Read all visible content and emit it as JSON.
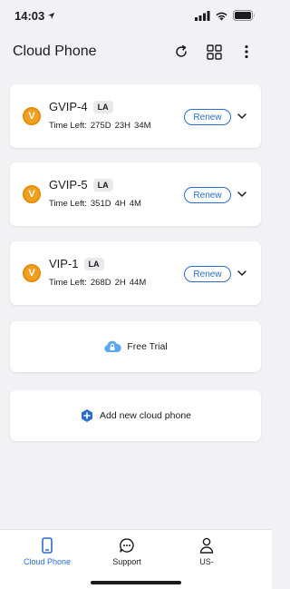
{
  "status_bar": {
    "time": "14:03"
  },
  "header": {
    "title": "Cloud Phone"
  },
  "phones": [
    {
      "badge": "V",
      "name": "GVIP-4",
      "region": "LA",
      "time_label": "Time Left:",
      "days": "275D",
      "hours": "23H",
      "minutes": "34M",
      "renew_label": "Renew"
    },
    {
      "badge": "V",
      "name": "GVIP-5",
      "region": "LA",
      "time_label": "Time Left:",
      "days": "351D",
      "hours": "4H",
      "minutes": "4M",
      "renew_label": "Renew"
    },
    {
      "badge": "V",
      "name": "VIP-1",
      "region": "LA",
      "time_label": "Time Left:",
      "days": "268D",
      "hours": "2H",
      "minutes": "44M",
      "renew_label": "Renew"
    }
  ],
  "free_trial": {
    "label": "Free Trial",
    "icon": "cloud-icon"
  },
  "add_phone": {
    "label": "Add new cloud phone",
    "icon": "plus-hexagon-icon"
  },
  "tabs": [
    {
      "label": "Cloud Phone",
      "icon": "phone-icon",
      "active": true
    },
    {
      "label": "Support",
      "icon": "chat-icon",
      "active": false
    },
    {
      "label": "US-",
      "icon": "person-icon",
      "active": false
    }
  ],
  "colors": {
    "accent": "#2b6cd0",
    "badge": "#f0a01e",
    "background": "#f2f2f4"
  }
}
